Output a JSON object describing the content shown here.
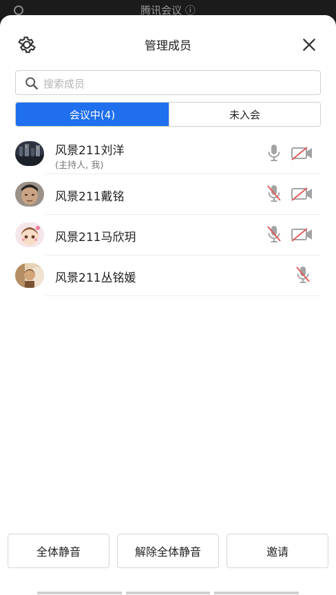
{
  "topbar": {
    "title": "腾讯会议 ⓘ"
  },
  "header": {
    "title": "管理成员"
  },
  "search": {
    "placeholder": "搜索成员"
  },
  "tabs": [
    {
      "label": "会议中(4)",
      "active": true
    },
    {
      "label": "未入会",
      "active": false
    }
  ],
  "members": [
    {
      "name": "风景211刘洋",
      "sub": "(主持人, 我)",
      "mic": "on",
      "camera": "off",
      "avatar": "city-night"
    },
    {
      "name": "风景211戴铭",
      "sub": "",
      "mic": "off",
      "camera": "off",
      "avatar": "man"
    },
    {
      "name": "风景211马欣玥",
      "sub": "",
      "mic": "off",
      "camera": "off",
      "avatar": "cartoon-girl"
    },
    {
      "name": "风景211丛铭媛",
      "sub": "",
      "mic": "off",
      "camera": "none",
      "avatar": "warm-photo"
    }
  ],
  "actions": {
    "mute_all": "全体静音",
    "unmute_all": "解除全体静音",
    "invite": "邀请"
  },
  "colors": {
    "accent": "#1f6fef",
    "muted_red": "#e25b5b",
    "icon_gray": "#9b9b9b"
  }
}
